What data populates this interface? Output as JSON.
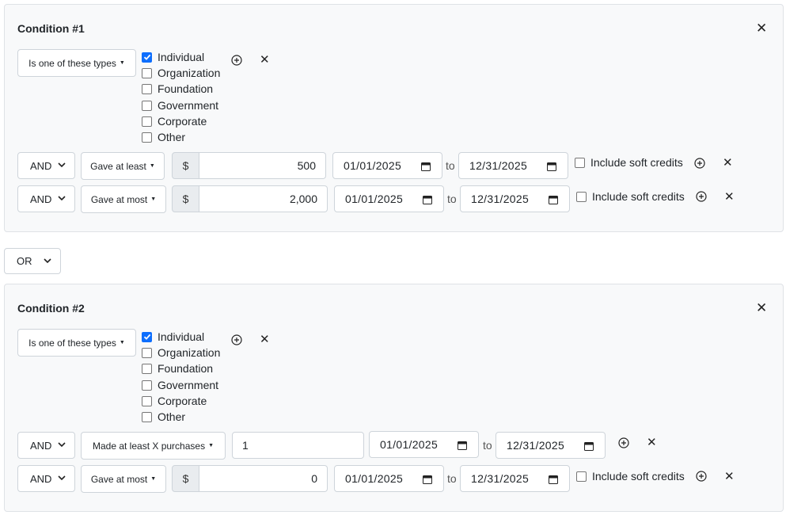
{
  "condition1": {
    "title": "Condition #1",
    "type_filter": "Is one of these types",
    "types": [
      {
        "label": "Individual",
        "checked": true
      },
      {
        "label": "Organization",
        "checked": false
      },
      {
        "label": "Foundation",
        "checked": false
      },
      {
        "label": "Government",
        "checked": false
      },
      {
        "label": "Corporate",
        "checked": false
      },
      {
        "label": "Other",
        "checked": false
      }
    ],
    "rows": [
      {
        "logic": "AND",
        "criterion": "Gave at least",
        "currency": "$",
        "amount": "500",
        "from": "01/01/2025",
        "to_word": "to",
        "to": "12/31/2025",
        "soft_credits": "Include soft credits"
      },
      {
        "logic": "AND",
        "criterion": "Gave at most",
        "currency": "$",
        "amount": "2,000",
        "from": "01/01/2025",
        "to_word": "to",
        "to": "12/31/2025",
        "soft_credits": "Include soft credits"
      }
    ]
  },
  "group_logic": "OR",
  "condition2": {
    "title": "Condition #2",
    "type_filter": "Is one of these types",
    "types": [
      {
        "label": "Individual",
        "checked": true
      },
      {
        "label": "Organization",
        "checked": false
      },
      {
        "label": "Foundation",
        "checked": false
      },
      {
        "label": "Government",
        "checked": false
      },
      {
        "label": "Corporate",
        "checked": false
      },
      {
        "label": "Other",
        "checked": false
      }
    ],
    "rows": [
      {
        "logic": "AND",
        "criterion": "Made at least X purchases",
        "count": "1",
        "from": "01/01/2025",
        "to_word": "to",
        "to": "12/31/2025"
      },
      {
        "logic": "AND",
        "criterion": "Gave at most",
        "currency": "$",
        "amount": "0",
        "from": "01/01/2025",
        "to_word": "to",
        "to": "12/31/2025",
        "soft_credits": "Include soft credits"
      }
    ]
  },
  "icons": {
    "close": "close-icon",
    "add": "plus-circle-icon",
    "remove": "x-icon",
    "calendar": "calendar-icon",
    "chevron": "chevron-down-icon"
  },
  "colors": {
    "checkbox_checked": "#0d6efd",
    "panel_bg": "#f8f9fa"
  }
}
